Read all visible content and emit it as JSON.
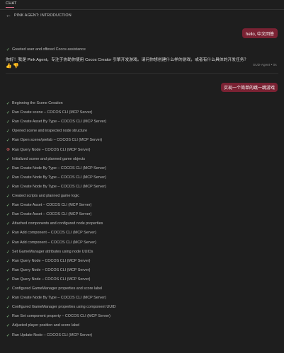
{
  "tabbar": {
    "chat_label": "CHAT"
  },
  "header": {
    "title": "PINK AGENT: INTRODUCTION"
  },
  "messages": {
    "user_1": "hello, 中文回答",
    "assistant_step": "Greeted user and offered Cocos assistance",
    "assistant_text": "你好！我是 Pink Agent，专注于协助你使用 Cocos Creator 引擎开发游戏。请问你想创建什么样的游戏，或者有什么具体的开发任务？",
    "assistant_meta": "SUD-Agent • 0s",
    "user_2": "实现一个简单的跳一跳游戏"
  },
  "steps": [
    {
      "label": "Beginning the Scene Creation",
      "status": "done"
    },
    {
      "label": "Ran Create scene – COCOS CLI (MCP Server)",
      "status": "done"
    },
    {
      "label": "Ran Create Asset By Type – COCOS CLI (MCP Server)",
      "status": "done"
    },
    {
      "label": "Opened scene and inspected node structure",
      "status": "done"
    },
    {
      "label": "Ran Open scene/prefab – COCOS CLI (MCP Server)",
      "status": "done"
    },
    {
      "label": "Ran Query Node – COCOS CLI (MCP Server)",
      "status": "error"
    },
    {
      "label": "Initialized scene and planned game objects",
      "status": "done"
    },
    {
      "label": "Ran Create Node By Type – COCOS CLI (MCP Server)",
      "status": "done"
    },
    {
      "label": "Ran Create Node By Type – COCOS CLI (MCP Server)",
      "status": "done"
    },
    {
      "label": "Ran Create Node By Type – COCOS CLI (MCP Server)",
      "status": "done"
    },
    {
      "label": "Created scripts and planned game logic",
      "status": "done"
    },
    {
      "label": "Ran Create Asset – COCOS CLI (MCP Server)",
      "status": "done"
    },
    {
      "label": "Ran Create Asset – COCOS CLI (MCP Server)",
      "status": "done"
    },
    {
      "label": "Attached components and configured node properties",
      "status": "done"
    },
    {
      "label": "Ran Add component – COCOS CLI (MCP Server)",
      "status": "done"
    },
    {
      "label": "Ran Add component – COCOS CLI (MCP Server)",
      "status": "done"
    },
    {
      "label": "Set GameManager attributes using node UUIDs",
      "status": "done"
    },
    {
      "label": "Ran Query Node – COCOS CLI (MCP Server)",
      "status": "done"
    },
    {
      "label": "Ran Query Node – COCOS CLI (MCP Server)",
      "status": "done"
    },
    {
      "label": "Ran Query Node – COCOS CLI (MCP Server)",
      "status": "done"
    },
    {
      "label": "Configured GameManager properties and score label",
      "status": "done"
    },
    {
      "label": "Ran Create Node By Type – COCOS CLI (MCP Server)",
      "status": "done"
    },
    {
      "label": "Configured GameManager properties using component UUID",
      "status": "done"
    },
    {
      "label": "Ran Set component property – COCOS CLI (MCP Server)",
      "status": "done"
    },
    {
      "label": "Adjusted player position and score label",
      "status": "done"
    },
    {
      "label": "Ran Update Node – COCOS CLI (MCP Server)",
      "status": "done"
    }
  ],
  "colors": {
    "user_bubble": "#7a2233",
    "accent": "#e06c8a",
    "success": "#7fb77e",
    "error": "#e06060"
  }
}
